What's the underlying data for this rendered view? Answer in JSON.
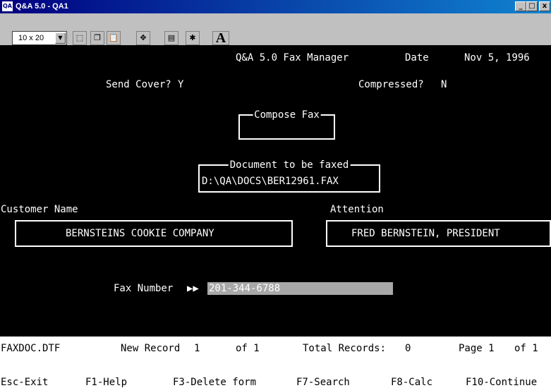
{
  "window": {
    "title": "Q&A 5.0 - QA1",
    "icon_text": "QA",
    "controls": [
      "_",
      "□",
      "x"
    ]
  },
  "toolbar": {
    "font_size": "10 x 20",
    "font_button_label": "A"
  },
  "screen": {
    "header": {
      "app": "Q&A 5.0 Fax Manager",
      "date_label": "Date",
      "date_value": "Nov 5, 1996"
    },
    "send_cover": {
      "label": "Send Cover?",
      "value": "Y"
    },
    "compressed": {
      "label": "Compressed?",
      "value": "N"
    },
    "compose_fax": {
      "label": "Compose Fax"
    },
    "document": {
      "label": "Document to be faxed",
      "path": "D:\\QA\\DOCS\\BER12961.FAX"
    },
    "customer": {
      "label": "Customer Name",
      "value": "BERNSTEINS COOKIE COMPANY"
    },
    "attention": {
      "label": "Attention",
      "value": "FRED BERNSTEIN, PRESIDENT"
    },
    "fax_number": {
      "label": "Fax Number",
      "marker": "▶▶",
      "value": "201-344-6788"
    }
  },
  "status": {
    "file": "FAXDOC.DTF",
    "record_label": "New Record",
    "record_num": "1",
    "record_of": "of 1",
    "total_label": "Total Records:",
    "total_value": "0",
    "page_label": "Page 1",
    "page_of": "of 1"
  },
  "function_keys": [
    {
      "label": "Esc-Exit"
    },
    {
      "label": "F1-Help"
    },
    {
      "label": "F3-Delete form"
    },
    {
      "label": "F7-Search"
    },
    {
      "label": "F8-Calc"
    },
    {
      "label": "F10-Continue"
    }
  ]
}
